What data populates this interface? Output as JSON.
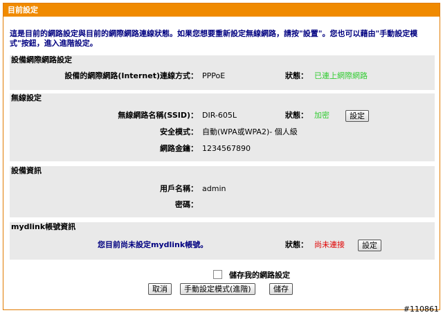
{
  "title": "目前設定",
  "intro": "這是目前的網路設定與目前的網際網路連線狀態。如果您想要重新設定無線網路，請按\"設置\"。您也可以藉由\"手動設定模式\"按鈕，進入進階設定。",
  "device_network": {
    "title": "設備網際網路設定",
    "connection_label": "設備的網際網路(Internet)連線方式：",
    "connection_value": "PPPoE",
    "status_label": "狀態：",
    "status_value": "已連上網際網路",
    "status_color": "#33cc33"
  },
  "wireless": {
    "title": "無線設定",
    "ssid_label": "無線網路名稱(SSID)：",
    "ssid_value": "DIR-605L",
    "status_label": "狀態：",
    "status_value": "加密",
    "status_color": "#33cc33",
    "setup_button": "設定",
    "security_label": "安全模式：",
    "security_value": "自動(WPA或WPA2)- 個人級",
    "key_label": "網路金鑰：",
    "key_value": "1234567890"
  },
  "device_info": {
    "title": "設備資訊",
    "username_label": "用戶名稱：",
    "username_value": "admin",
    "password_label": "密碼：",
    "password_value": ""
  },
  "mydlink": {
    "title": "mydlink帳號資訊",
    "message": "您目前尚未設定mydlink帳號。",
    "status_label": "狀態：",
    "status_value": "尚未連接",
    "status_color": "#e00000",
    "setup_button": "設定"
  },
  "save_settings": {
    "checkbox_label": "儲存我的網路設定",
    "checked": false
  },
  "buttons": {
    "cancel": "取消",
    "manual": "手動設定模式(進階)",
    "save": "儲存"
  },
  "watermark": "#110861",
  "accent_color": "#f08a00"
}
